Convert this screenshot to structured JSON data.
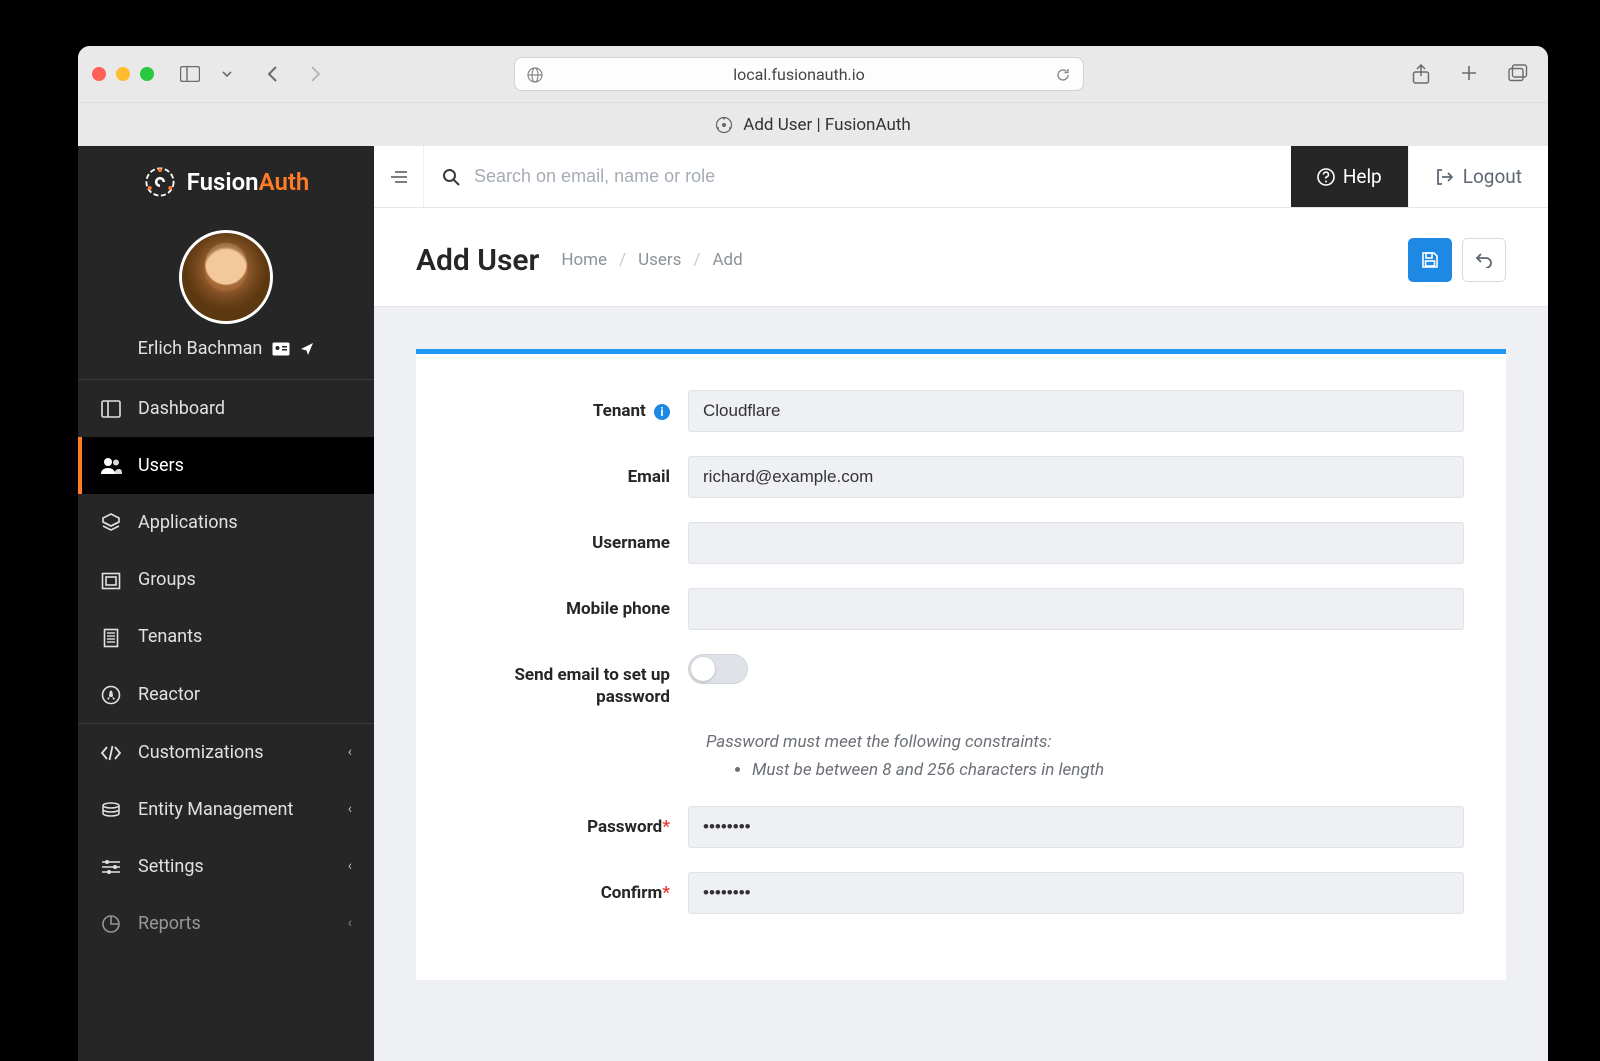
{
  "browser": {
    "address": "local.fusionauth.io",
    "tab_title": "Add User | FusionAuth"
  },
  "brand": {
    "name_a": "Fusion",
    "name_b": "Auth"
  },
  "profile": {
    "name": "Erlich Bachman"
  },
  "sidebar": {
    "items": [
      {
        "label": "Dashboard",
        "icon": "dashboard-icon",
        "expandable": false
      },
      {
        "label": "Users",
        "icon": "users-icon",
        "expandable": false,
        "active": true
      },
      {
        "label": "Applications",
        "icon": "applications-icon",
        "expandable": false
      },
      {
        "label": "Groups",
        "icon": "groups-icon",
        "expandable": false
      },
      {
        "label": "Tenants",
        "icon": "tenants-icon",
        "expandable": false
      },
      {
        "label": "Reactor",
        "icon": "reactor-icon",
        "expandable": false
      },
      {
        "label": "Customizations",
        "icon": "customizations-icon",
        "expandable": true
      },
      {
        "label": "Entity Management",
        "icon": "entity-icon",
        "expandable": true
      },
      {
        "label": "Settings",
        "icon": "settings-icon",
        "expandable": true
      },
      {
        "label": "Reports",
        "icon": "reports-icon",
        "expandable": true
      }
    ]
  },
  "topbar": {
    "search_placeholder": "Search on email, name or role",
    "help": "Help",
    "logout": "Logout"
  },
  "page": {
    "title": "Add User",
    "breadcrumbs": [
      "Home",
      "Users",
      "Add"
    ]
  },
  "form": {
    "tenant": {
      "label": "Tenant",
      "value": "Cloudflare"
    },
    "email": {
      "label": "Email",
      "value": "richard@example.com"
    },
    "username": {
      "label": "Username",
      "value": ""
    },
    "mobile": {
      "label": "Mobile phone",
      "value": ""
    },
    "send_email": {
      "label": "Send email to set up password"
    },
    "constraints": {
      "title": "Password must meet the following constraints:",
      "items": [
        "Must be between 8 and 256 characters in length"
      ]
    },
    "password": {
      "label": "Password",
      "value": "••••••••"
    },
    "confirm": {
      "label": "Confirm",
      "value": "••••••••"
    }
  }
}
